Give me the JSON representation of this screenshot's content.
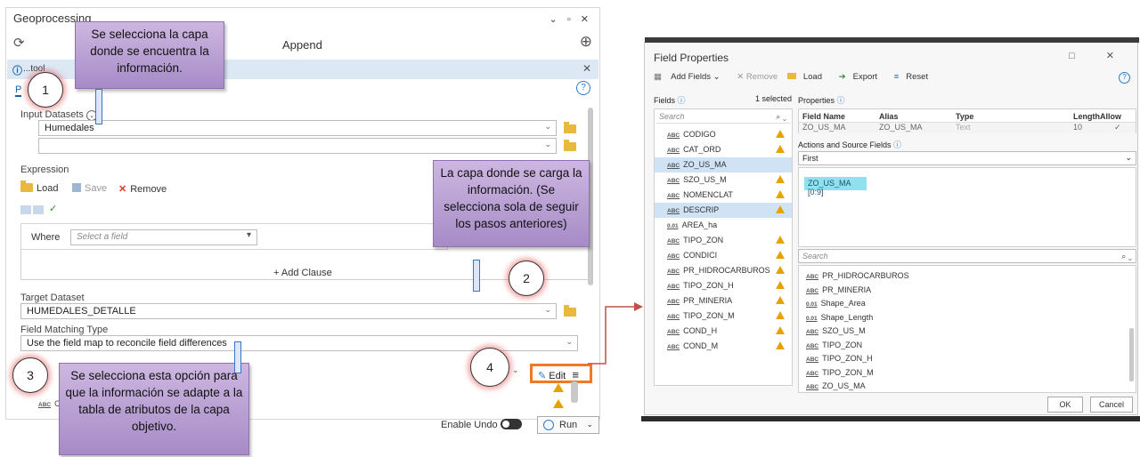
{
  "geo": {
    "title": "Geoprocessing",
    "window_controls": "⌄ ▫ ✕",
    "tool_name": "Append",
    "infobar_text": "...tool",
    "pane_tab": "P",
    "input_datasets_label": "Input Datasets",
    "input_dataset_value": "Humedales",
    "expression_label": "Expression",
    "load": "Load",
    "save": "Save",
    "remove": "Remove",
    "where": "Where",
    "select_field_placeholder": "Select a field",
    "add_clause": "+ Add Clause",
    "target_dataset_label": "Target Dataset",
    "target_dataset_value": "HUMEDALES_DETALLE",
    "field_matching_label": "Field Matching Type",
    "field_matching_value": "Use the field map to reconcile field differences",
    "edit": "Edit",
    "enable_undo": "Enable Undo",
    "run": "Run",
    "field_rows": [
      "C",
      "C"
    ]
  },
  "callouts": {
    "c1": "Se selecciona la capa donde se encuentra la información.",
    "c2": "La capa donde se carga la información. (Se selecciona sola de seguir los pasos anteriores)",
    "c3": "Se selecciona esta opción para que la información se adapte a la tabla de atributos de la capa objetivo.",
    "n1": "1",
    "n2": "2",
    "n3": "3",
    "n4": "4"
  },
  "fp": {
    "title": "Field Properties",
    "window_controls": "□ ✕",
    "add_fields": "Add Fields ⌄",
    "remove": "✕ Remove",
    "load": "Load",
    "export": "Export",
    "reset": "Reset",
    "fields_label": "Fields",
    "selected_count": "1 selected",
    "properties_label": "Properties",
    "search": "Search",
    "fields": [
      {
        "type": "ABC",
        "name": "CODIGO",
        "warn": true
      },
      {
        "type": "ABC",
        "name": "CAT_ORD",
        "warn": true
      },
      {
        "type": "ABC",
        "name": "ZO_US_MA",
        "warn": false
      },
      {
        "type": "ABC",
        "name": "SZO_US_M",
        "warn": true
      },
      {
        "type": "ABC",
        "name": "NOMENCLAT",
        "warn": true
      },
      {
        "type": "ABC",
        "name": "DESCRIP",
        "warn": true
      },
      {
        "type": "0.01",
        "name": "AREA_ha",
        "warn": false
      },
      {
        "type": "ABC",
        "name": "TIPO_ZON",
        "warn": true
      },
      {
        "type": "ABC",
        "name": "CONDICI",
        "warn": true
      },
      {
        "type": "ABC",
        "name": "PR_HIDROCARBUROS",
        "warn": true
      },
      {
        "type": "ABC",
        "name": "TIPO_ZON_H",
        "warn": true
      },
      {
        "type": "ABC",
        "name": "PR_MINERIA",
        "warn": true
      },
      {
        "type": "ABC",
        "name": "TIPO_ZON_M",
        "warn": true
      },
      {
        "type": "ABC",
        "name": "COND_H",
        "warn": true
      },
      {
        "type": "ABC",
        "name": "COND_M",
        "warn": true
      }
    ],
    "grid_headers": [
      "Field Name",
      "Alias",
      "Type",
      "Length",
      "Allow NULL"
    ],
    "grid_values": [
      "ZO_US_MA",
      "ZO_US_MA",
      "Text",
      "10",
      "✓"
    ],
    "actions_label": "Actions and Source Fields",
    "merge_rule": "First",
    "source_chip": "ZO_US_MA [0:9]",
    "search2": "Search",
    "source_fields": [
      {
        "type": "ABC",
        "name": "PR_HIDROCARBUROS"
      },
      {
        "type": "ABC",
        "name": "PR_MINERIA"
      },
      {
        "type": "0.01",
        "name": "Shape_Area"
      },
      {
        "type": "0.01",
        "name": "Shape_Length"
      },
      {
        "type": "ABC",
        "name": "SZO_US_M"
      },
      {
        "type": "ABC",
        "name": "TIPO_ZON"
      },
      {
        "type": "ABC",
        "name": "TIPO_ZON_H"
      },
      {
        "type": "ABC",
        "name": "TIPO_ZON_M"
      },
      {
        "type": "ABC",
        "name": "ZO_US_MA"
      }
    ],
    "ok": "OK",
    "cancel": "Cancel"
  }
}
